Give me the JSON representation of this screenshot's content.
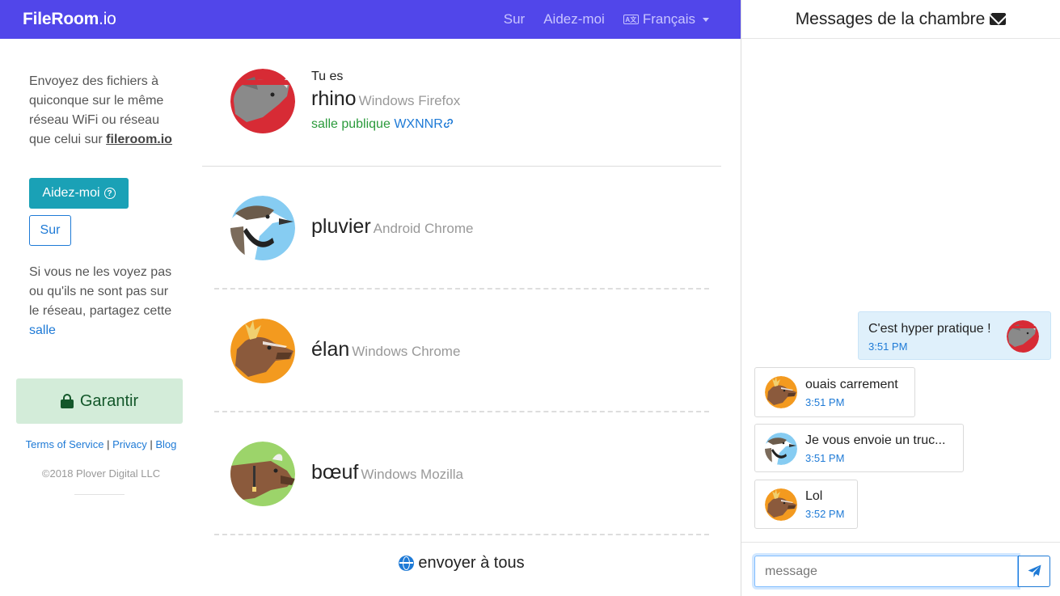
{
  "navbar": {
    "brand_main": "FileRoom",
    "brand_tld": ".io",
    "links": [
      "Sur",
      "Aidez-moi"
    ],
    "language": "Français",
    "language_icon_text": "A文",
    "bg_color": "#5146ea"
  },
  "sidebar": {
    "intro_text": "Envoyez des fichiers à quiconque sur le même réseau WiFi ou réseau que celui sur",
    "intro_link": "fileroom.io",
    "help_button": "Aidez-moi",
    "about_button": "Sur",
    "hint_text": "Si vous ne les voyez pas ou qu'ils ne sont pas sur le réseau, partagez cette",
    "hint_link": "salle",
    "secure_button": "Garantir",
    "footer": {
      "terms": "Terms of Service",
      "privacy": "Privacy",
      "blog": "Blog",
      "separator": "|",
      "copyright": "©2018 Plover Digital LLC"
    }
  },
  "self": {
    "you_are": "Tu es",
    "name": "rhino",
    "device": "Windows Firefox",
    "room_label": "salle publique",
    "room_code": "WXNNR",
    "avatar": "rhino-avatar"
  },
  "peers": [
    {
      "name": "pluvier",
      "device": "Android Chrome",
      "avatar": "plover-avatar"
    },
    {
      "name": "élan",
      "device": "Windows Chrome",
      "avatar": "elk-avatar"
    },
    {
      "name": "bœuf",
      "device": "Windows Mozilla",
      "avatar": "ox-avatar"
    }
  ],
  "send_all": "envoyer à tous",
  "chat": {
    "title": "Messages de la chambre",
    "messages": [
      {
        "text": "C'est hyper pratique !",
        "time": "3:51 PM",
        "from": "rhino",
        "mine": true
      },
      {
        "text": "ouais carrement",
        "time": "3:51 PM",
        "from": "élan",
        "mine": false
      },
      {
        "text": "Je vous envoie un truc...",
        "time": "3:51 PM",
        "from": "pluvier",
        "mine": false
      },
      {
        "text": "Lol",
        "time": "3:52 PM",
        "from": "élan",
        "mine": false
      }
    ],
    "input_placeholder": "message",
    "send_icon": "paper-plane-icon"
  },
  "colors": {
    "accent": "#5146ea",
    "link": "#1e7ad6",
    "help_button": "#1aa1b6",
    "secure_bg": "#d3ecd9",
    "room_green": "#2a9a3b"
  }
}
